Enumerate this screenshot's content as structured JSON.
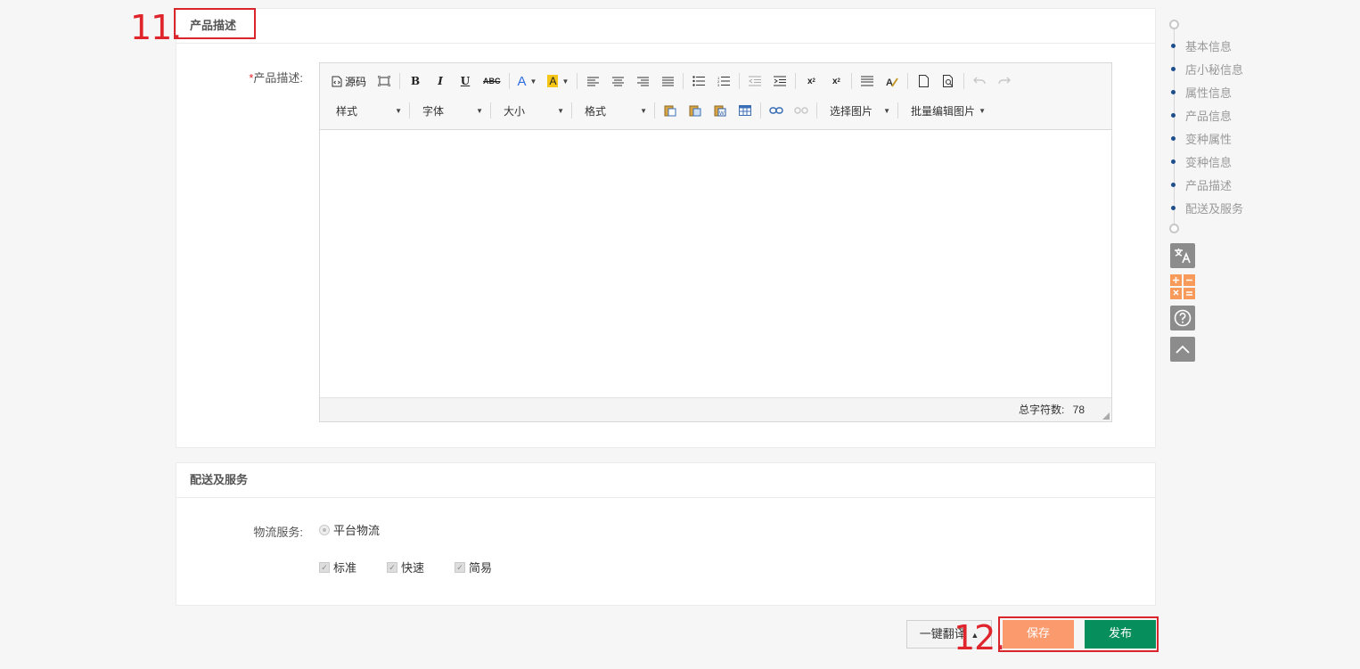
{
  "annotations": {
    "step11": "11.",
    "step12": "12."
  },
  "description_section": {
    "title": "产品描述",
    "field_label": "产品描述:",
    "required_mark": "*",
    "toolbar": {
      "source_label": "源码",
      "style_dropdown": "样式",
      "font_dropdown": "字体",
      "size_dropdown": "大小",
      "format_dropdown": "格式",
      "select_image": "选择图片",
      "batch_edit_image": "批量编辑图片"
    },
    "char_count_label": "总字符数:",
    "char_count_value": "78"
  },
  "shipping_section": {
    "title": "配送及服务",
    "field_label": "物流服务:",
    "radio_option": "平台物流",
    "checkboxes": [
      "标准",
      "快速",
      "简易"
    ]
  },
  "actions": {
    "translate": "一键翻译",
    "save": "保存",
    "publish": "发布"
  },
  "side_nav": {
    "items": [
      "基本信息",
      "店小秘信息",
      "属性信息",
      "产品信息",
      "变种属性",
      "变种信息",
      "产品描述",
      "配送及服务"
    ]
  },
  "colors": {
    "save": "#fb9a6c",
    "publish": "#078e5d",
    "annotation": "#e0242b",
    "nav_dot": "#1f4e8c"
  }
}
